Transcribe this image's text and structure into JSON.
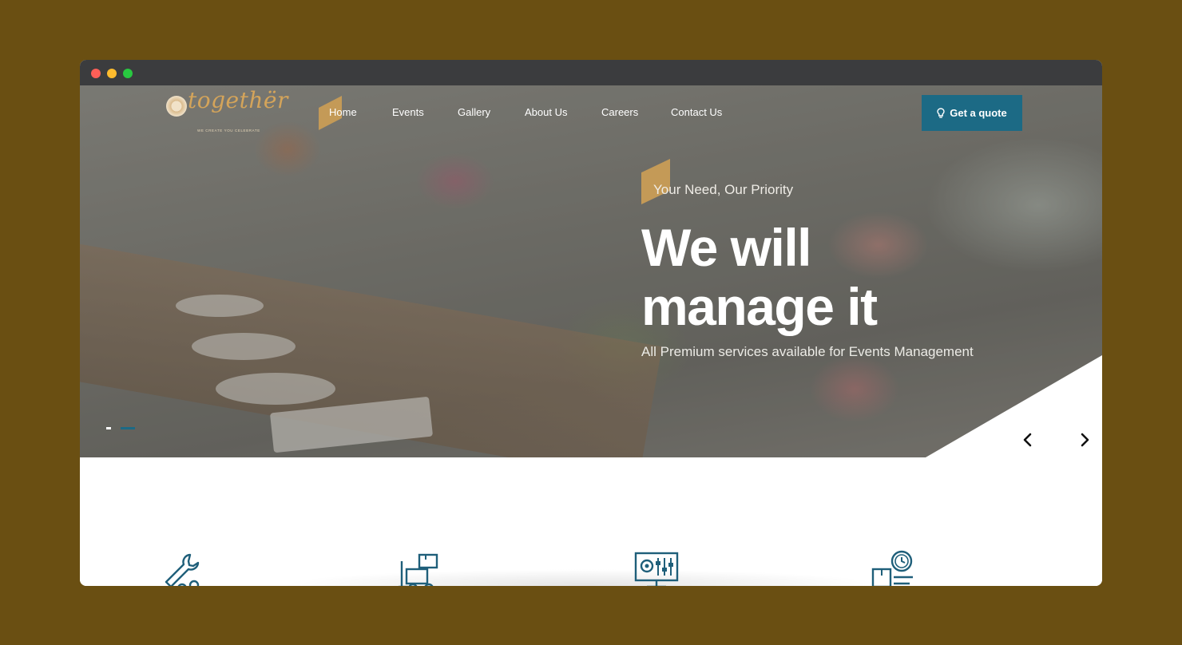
{
  "brand": {
    "name": "togethër",
    "tagline": "WE CREATE YOU CELEBRATE"
  },
  "nav": {
    "items": [
      "Home",
      "Events",
      "Gallery",
      "About Us",
      "Careers",
      "Contact Us"
    ],
    "active": "Home",
    "cta_label": "Get a quote"
  },
  "hero": {
    "subtitle": "Your Need, Our Priority",
    "headline": "We will manage it",
    "description": "All Premium services available for Events Management",
    "slides_count": 2,
    "active_slide": 1
  },
  "features": {
    "icons": [
      "wrench-gear-icon",
      "forklift-icon",
      "control-panel-icon",
      "package-clock-icon"
    ]
  },
  "colors": {
    "accent_gold": "#c49a57",
    "brand_blue": "#1c6a85",
    "icon_blue": "#1f5f7a",
    "page_background": "#6a4f12"
  }
}
